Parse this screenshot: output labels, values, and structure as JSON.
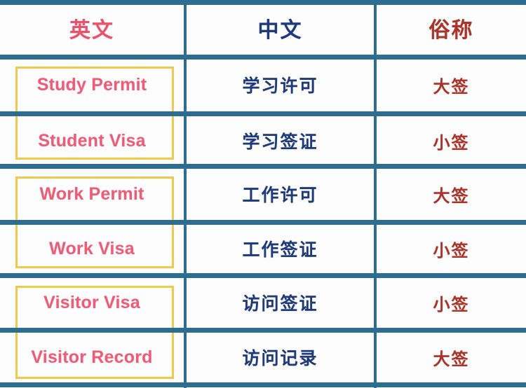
{
  "table": {
    "headers": {
      "english": "英文",
      "chinese": "中文",
      "nickname": "俗称"
    },
    "rows": [
      {
        "english": "Study Permit",
        "chinese": "学习许可",
        "nickname": "大签"
      },
      {
        "english": "Student Visa",
        "chinese": "学习签证",
        "nickname": "小签"
      },
      {
        "english": "Work Permit",
        "chinese": "工作许可",
        "nickname": "大签"
      },
      {
        "english": "Work Visa",
        "chinese": "工作签证",
        "nickname": "小签"
      },
      {
        "english": "Visitor Visa",
        "chinese": "访问签证",
        "nickname": "小签"
      },
      {
        "english": "Visitor Record",
        "chinese": "访问记录",
        "nickname": "大签"
      }
    ],
    "groups": [
      {
        "label": "study-group",
        "rows": [
          0,
          1
        ]
      },
      {
        "label": "work-group",
        "rows": [
          2,
          3
        ]
      },
      {
        "label": "visitor-group",
        "rows": [
          4,
          5
        ]
      }
    ],
    "colors": {
      "grid_line": "#2c6e91",
      "highlight_box": "#f2c94c",
      "english_text": "#ee5d77",
      "chinese_text": "#1f3a78",
      "nickname_text": "#a8342a",
      "header_english": "#e8546b",
      "header_chinese": "#1f3a78",
      "header_nickname": "#a8342a",
      "background": "#fdfdfd"
    }
  }
}
